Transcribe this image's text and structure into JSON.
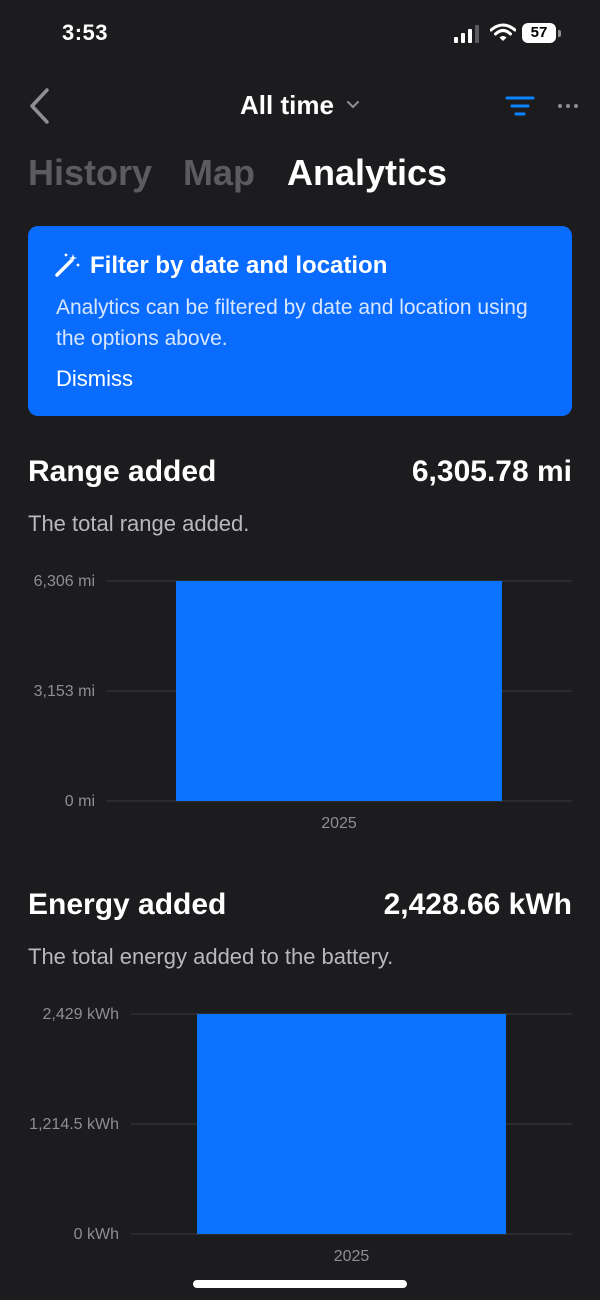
{
  "status": {
    "time": "3:53",
    "battery": "57"
  },
  "nav": {
    "title": "All time"
  },
  "tabs": [
    {
      "label": "History",
      "active": false
    },
    {
      "label": "Map",
      "active": false
    },
    {
      "label": "Analytics",
      "active": true
    }
  ],
  "banner": {
    "title": "Filter by date and location",
    "text": "Analytics can be filtered by date and location using the options above.",
    "dismiss": "Dismiss"
  },
  "range": {
    "title": "Range added",
    "value": "6,305.78 mi",
    "description": "The total range added."
  },
  "energy": {
    "title": "Energy added",
    "value": "2,428.66 kWh",
    "description": "The total energy added to the battery."
  },
  "colors": {
    "accent": "#0a6cff",
    "bar": "#0a74ff",
    "background": "#1c1c1e"
  },
  "chart_data": [
    {
      "type": "bar",
      "categories": [
        "2025"
      ],
      "values": [
        6305.78
      ],
      "ylim": [
        0,
        6306
      ],
      "yticks": [
        0,
        3153,
        6306
      ],
      "ytick_labels": [
        "0 mi",
        "3,153 mi",
        "6,306 mi"
      ],
      "grid": true
    },
    {
      "type": "bar",
      "categories": [
        "2025"
      ],
      "values": [
        2428.66
      ],
      "ylim": [
        0,
        2429
      ],
      "yticks": [
        0,
        1214.5,
        2429
      ],
      "ytick_labels": [
        "0 kWh",
        "1,214.5 kWh",
        "2,429 kWh"
      ],
      "grid": true
    }
  ]
}
